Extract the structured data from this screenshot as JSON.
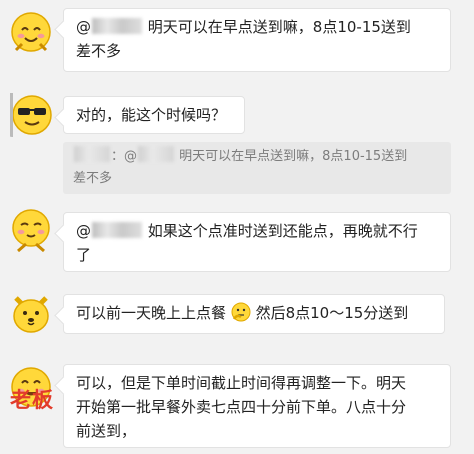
{
  "messages": [
    {
      "mention": "@",
      "text": "明天可以在早点送到嘛，8点10-15送到",
      "text2": "差不多"
    },
    {
      "text": "对的，能这个时候吗？",
      "quote": {
        "sep": "：@",
        "text": "明天可以在早点送到嘛，8点10-15送到",
        "text2": "差不多"
      }
    },
    {
      "mention": "@",
      "text": "如果这个点准时送到还能点，再晚就不行",
      "text2": "了"
    },
    {
      "text_a": "可以前一天晚上上点餐",
      "text_b": "然后8点10～15分送到"
    },
    {
      "text": "可以，但是下单时间截止时间得再调整一下。明天",
      "text2": "开始第一批早餐外卖七点四十分前下单。八点十分",
      "text3": "前送到，",
      "sender_label": "老板"
    }
  ],
  "colors": {
    "background": "#f2f2f2",
    "bubble": "#ffffff",
    "quote": "#e8e8e8",
    "boss_label": "#e23b2a"
  },
  "icons": [
    "smiling-face-icon",
    "sunglasses-face-icon",
    "shy-face-icon",
    "dog-face-icon",
    "thinking-face-icon",
    "grinning-face-icon"
  ]
}
